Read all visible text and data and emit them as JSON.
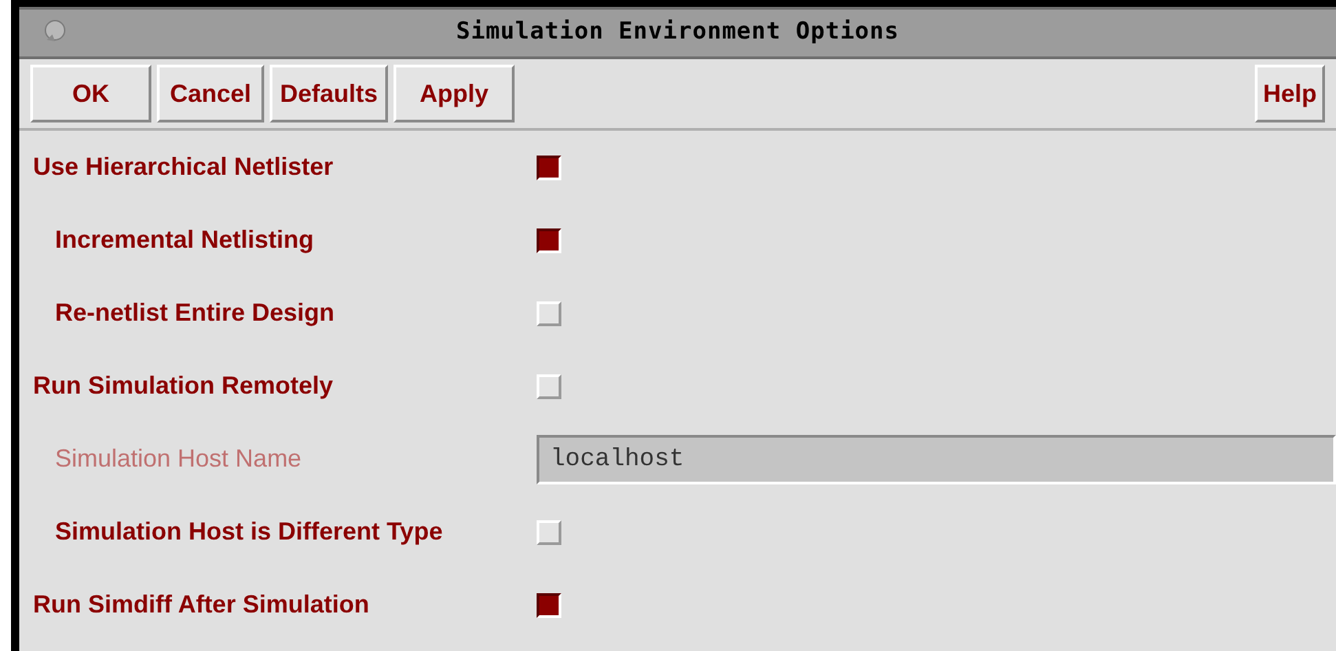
{
  "window": {
    "title": "Simulation Environment Options"
  },
  "buttons": [
    {
      "label": "OK"
    },
    {
      "label": "Cancel"
    },
    {
      "label": "Defaults"
    },
    {
      "label": "Apply"
    }
  ],
  "help_button": {
    "label": "Help"
  },
  "options": [
    {
      "kind": "checkbox",
      "label": "Use Hierarchical Netlister",
      "checked": true,
      "children": [
        {
          "kind": "checkbox",
          "label": "Incremental Netlisting",
          "checked": true
        },
        {
          "kind": "checkbox",
          "label": "Re-netlist Entire Design",
          "checked": false
        }
      ]
    },
    {
      "kind": "checkbox",
      "label": "Run Simulation Remotely",
      "checked": false,
      "children": [
        {
          "kind": "text_field",
          "label": "Simulation Host Name",
          "value": "localhost",
          "disabled": true
        },
        {
          "kind": "checkbox",
          "label": "Simulation Host is Different Type",
          "checked": false
        }
      ]
    },
    {
      "kind": "checkbox",
      "label": "Run Simdiff After Simulation",
      "checked": true
    }
  ]
}
